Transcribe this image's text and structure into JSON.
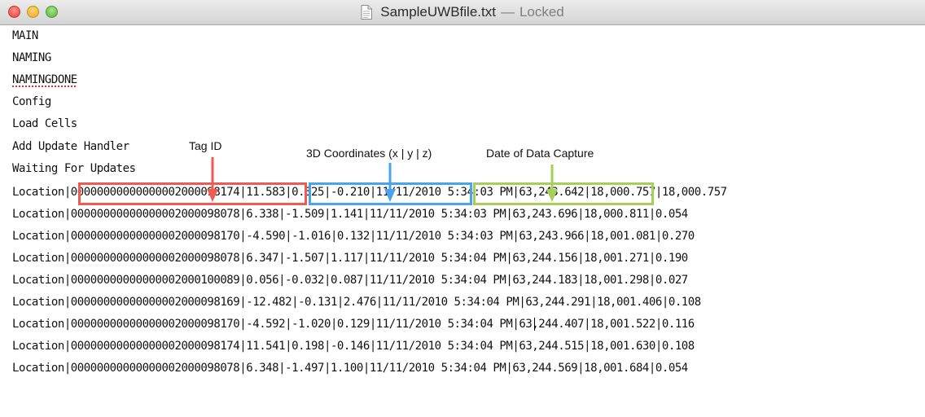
{
  "window": {
    "title": "SampleUWBfile.txt",
    "title_separator": "—",
    "status": "Locked"
  },
  "lines": [
    "MAIN",
    "NAMING",
    "NAMINGDONE",
    "Config",
    "Load Cells",
    "Add Update Handler",
    "Waiting For Updates",
    "Location|00000000000000002000098174|11.583|0.325|-0.210|11/11/2010 5:34:03 PM|63,243.642|18,000.757|18,000.757",
    "Location|00000000000000002000098078|6.338|-1.509|1.141|11/11/2010 5:34:03 PM|63,243.696|18,000.811|0.054",
    "Location|00000000000000002000098170|-4.590|-1.016|0.132|11/11/2010 5:34:03 PM|63,243.966|18,001.081|0.270",
    "Location|00000000000000002000098078|6.347|-1.507|1.117|11/11/2010 5:34:04 PM|63,244.156|18,001.271|0.190",
    "Location|00000000000000002000100089|0.056|-0.032|0.087|11/11/2010 5:34:04 PM|63,244.183|18,001.298|0.027",
    "Location|00000000000000002000098169|-12.482|-0.131|2.476|11/11/2010 5:34:04 PM|63,244.291|18,001.406|0.108",
    "Location|00000000000000002000098170|-4.592|-1.020|0.129|11/11/2010 5:34:04 PM|63,244.407|18,001.522|0.116",
    "Location|00000000000000002000098174|11.541|0.198|-0.146|11/11/2010 5:34:04 PM|63,244.515|18,001.630|0.108",
    "Location|00000000000000002000098078|6.348|-1.497|1.100|11/11/2010 5:34:04 PM|63,244.569|18,001.684|0.054"
  ],
  "annotations": {
    "tag_id": "Tag ID",
    "coordinates": "3D Coordinates (x | y | z)",
    "date": "Date of Data Capture"
  },
  "colors": {
    "tag_id": "#f05a50",
    "coordinates": "#4aa3ee",
    "date": "#a4cf5a",
    "spellcheck": "#e52b2b"
  },
  "icons": {
    "close": "close-button-icon",
    "minimize": "minimize-button-icon",
    "zoom": "zoom-button-icon",
    "document": "text-document-icon"
  }
}
